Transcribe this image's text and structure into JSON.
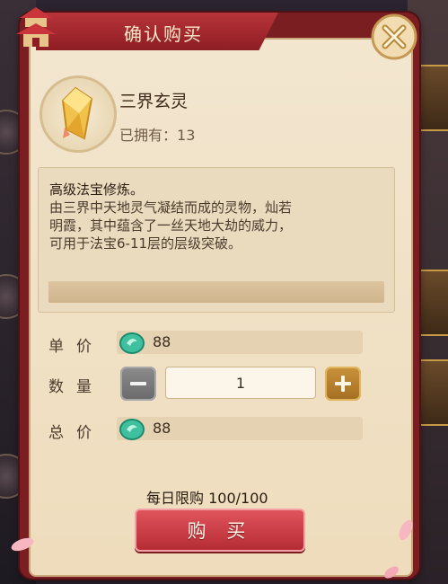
{
  "dialog": {
    "title": "确认购买"
  },
  "item": {
    "name": "三界玄灵",
    "owned_label": "已拥有：",
    "owned_count": "13",
    "icon": "crystal-icon"
  },
  "description": {
    "title": "高级法宝修炼。",
    "body": "由三界中天地灵气凝结而成的灵物，灿若\n明霞，其中蕴含了一丝天地大劫的威力，\n可用于法宝6-11层的层级突破。"
  },
  "purchase": {
    "unit_price_label": "单价",
    "unit_price": "88",
    "quantity_label": "数量",
    "quantity": "1",
    "total_label": "总价",
    "total": "88",
    "currency_icon": "jade-currency-icon",
    "daily_limit": "每日限购 100/100",
    "buy_label": "购 买"
  },
  "colors": {
    "frame": "#7a1e22",
    "panel": "#f3e6cf",
    "buy_button": "#d14550",
    "plus_button": "#c8923c",
    "minus_button": "#7d7d7d"
  }
}
